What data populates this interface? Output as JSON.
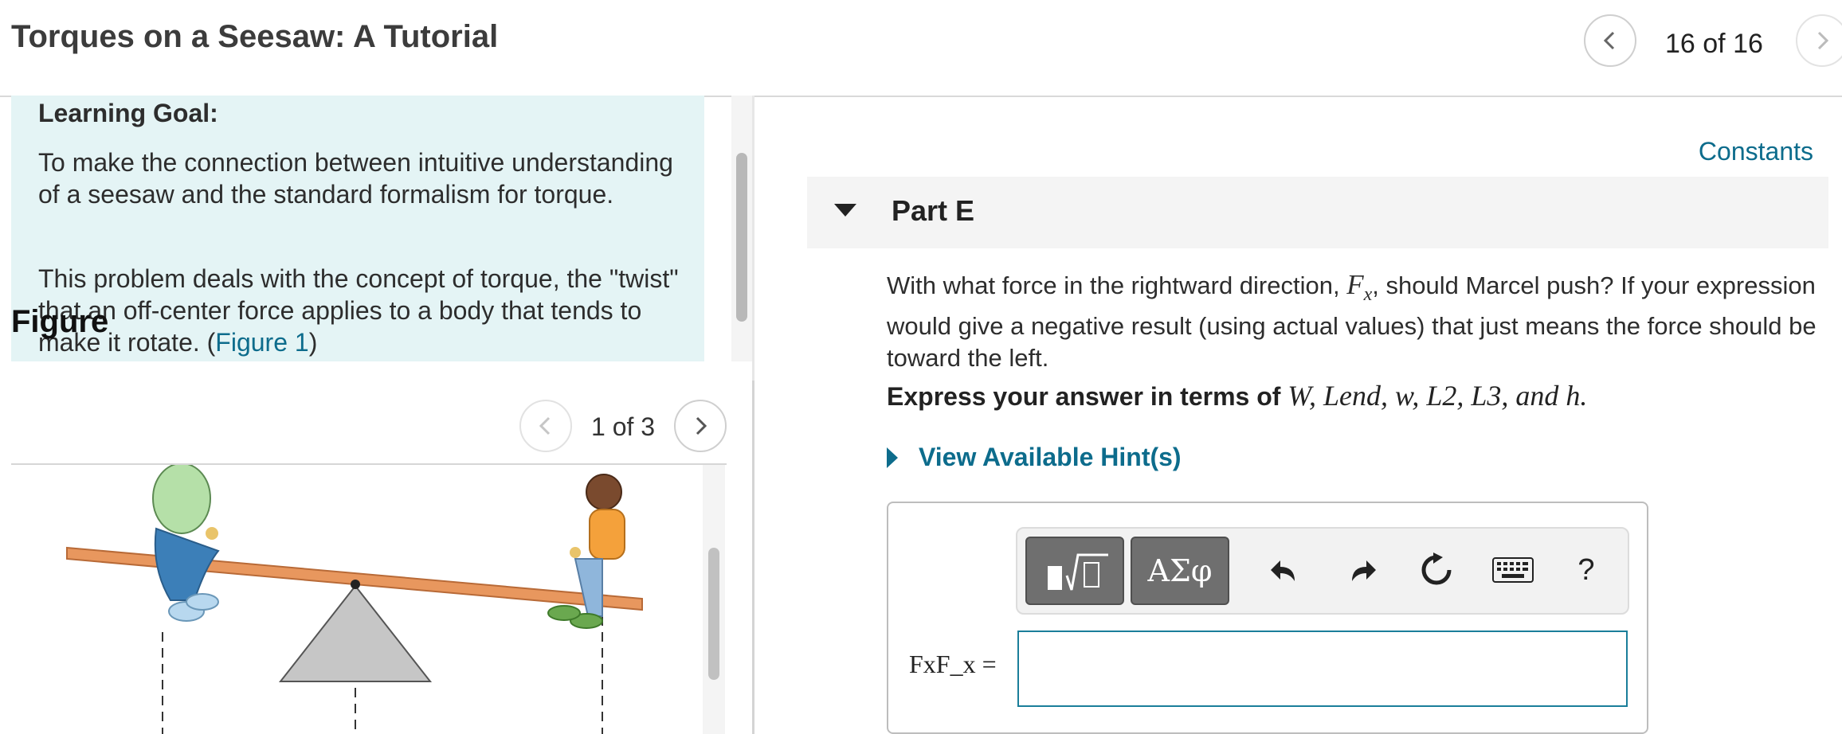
{
  "header": {
    "title": "Torques on a Seesaw: A Tutorial",
    "counter": "16 of 16"
  },
  "learning_goal": {
    "heading": "Learning Goal:",
    "paragraph1": "To make the connection between intuitive understanding of a seesaw and the standard formalism for torque.",
    "paragraph2_before": "This problem deals with the concept of torque, the \"twist\" that an off-center force applies to a body that tends to make it rotate. (",
    "paragraph2_link": "Figure 1",
    "paragraph2_after": ")"
  },
  "figure": {
    "heading": "Figure",
    "counter": "1 of 3"
  },
  "part": {
    "constants_link": "Constants",
    "label": "Part E",
    "question_before": "With what force in the rightward direction, ",
    "question_var": "F",
    "question_var_sub": "x",
    "question_after": ", should Marcel push? If your expression would give a negative result (using actual values) that just means the force should be toward the left.",
    "express_prefix": "Express your answer in terms of ",
    "express_vars": "W, Lend, w, L2, L3, and h.",
    "hint_label": "View Available Hint(s)"
  },
  "answer": {
    "label": "FxF_x =",
    "value": "",
    "toolbar": {
      "templates_icon": "fraction-sqrt-icon",
      "symbols_label": "ΑΣφ",
      "undo_icon": "undo-icon",
      "redo_icon": "redo-icon",
      "reset_icon": "reset-icon",
      "keyboard_icon": "keyboard-icon",
      "help_label": "?"
    }
  },
  "colors": {
    "accent": "#0d6c8c",
    "goal_bg": "#e4f4f5",
    "input_border": "#1a7e9a"
  }
}
